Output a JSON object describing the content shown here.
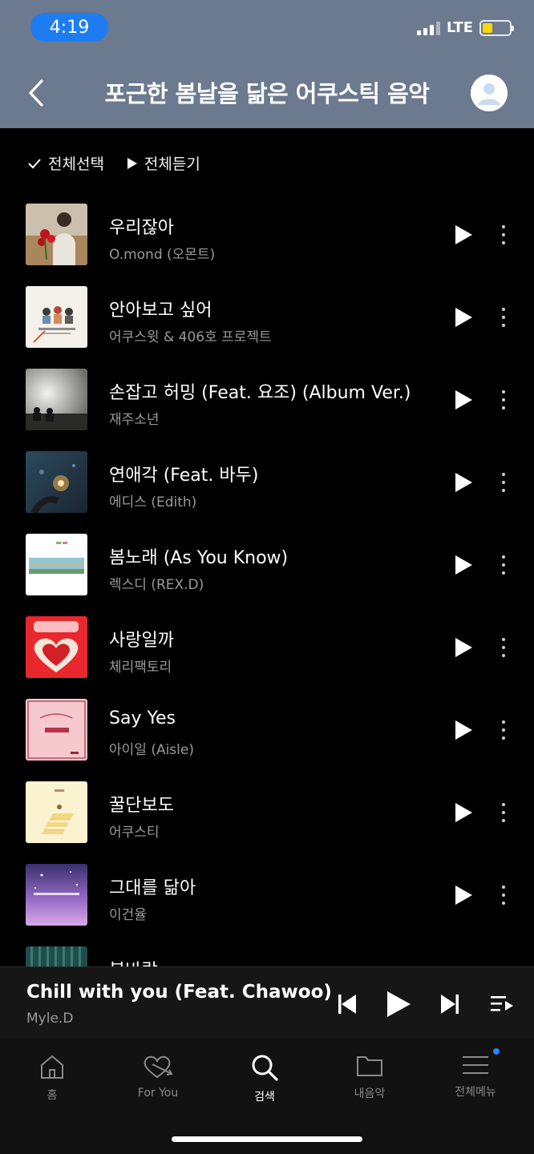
{
  "status_bar": {
    "time": "4:19",
    "network": "LTE"
  },
  "header": {
    "title": "포근한 봄날을 닮은 어쿠스틱 음악"
  },
  "controls": {
    "select_all": "전체선택",
    "play_all": "전체듣기"
  },
  "songs": [
    {
      "title": "우리잖아",
      "artist": "O.mond (오몬트)"
    },
    {
      "title": "안아보고 싶어",
      "artist": "어쿠스윗 & 406호 프로젝트"
    },
    {
      "title": "손잡고 허밍 (Feat. 요조) (Album Ver.)",
      "artist": "재주소년"
    },
    {
      "title": "연애각 (Feat. 바두)",
      "artist": "에디스 (Edith)"
    },
    {
      "title": "봄노래 (As You Know)",
      "artist": "렉스디 (REX.D)"
    },
    {
      "title": "사랑일까",
      "artist": "체리팩토리"
    },
    {
      "title": "Say Yes",
      "artist": "아이일 (Aisle)"
    },
    {
      "title": "꿀단보도",
      "artist": "어쿠스티"
    },
    {
      "title": "그대를 닮아",
      "artist": "이건율"
    },
    {
      "title": "봄바람",
      "artist": ""
    }
  ],
  "now_playing": {
    "title": "Chill with you (Feat. Chawoo)",
    "artist": "Myle.D"
  },
  "nav": {
    "home": "홈",
    "for_you": "For You",
    "search": "검색",
    "my_music": "내음악",
    "menu": "전체메뉴"
  },
  "colors": {
    "header_bg": "#6b7a8f",
    "time_pill": "#1e7cf2",
    "battery": "#ffd60a",
    "notification_dot": "#1e88ff"
  }
}
